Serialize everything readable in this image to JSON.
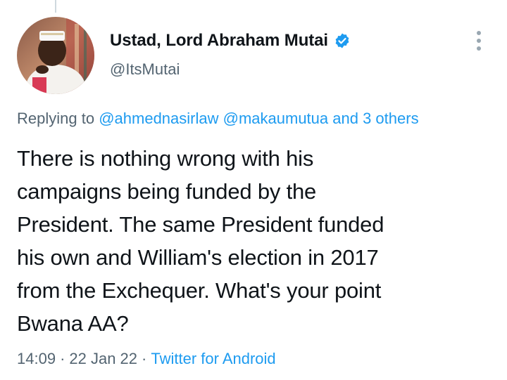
{
  "author": {
    "display_name": "Ustad, Lord Abraham Mutai",
    "handle": "@ItsMutai",
    "verified": true
  },
  "reply_context": {
    "prefix": "Replying to",
    "mention_1": "@ahmednasirlaw",
    "mention_2": "@makaumutua",
    "others": "and 3 others"
  },
  "tweet": {
    "lines": [
      "There is nothing wrong with his",
      "campaigns being funded by the",
      "President. The same President funded",
      "his own and William's election in 2017",
      "from the Exchequer. What's your point",
      "Bwana AA?"
    ]
  },
  "meta": {
    "time": "14:09",
    "separator": "·",
    "date": "22 Jan 22",
    "source": "Twitter for Android"
  },
  "icons": {
    "verified": "verified-badge-icon",
    "more": "more-options-icon"
  },
  "colors": {
    "text": "#0f1419",
    "secondary": "#536471",
    "link": "#1d9bf0"
  }
}
